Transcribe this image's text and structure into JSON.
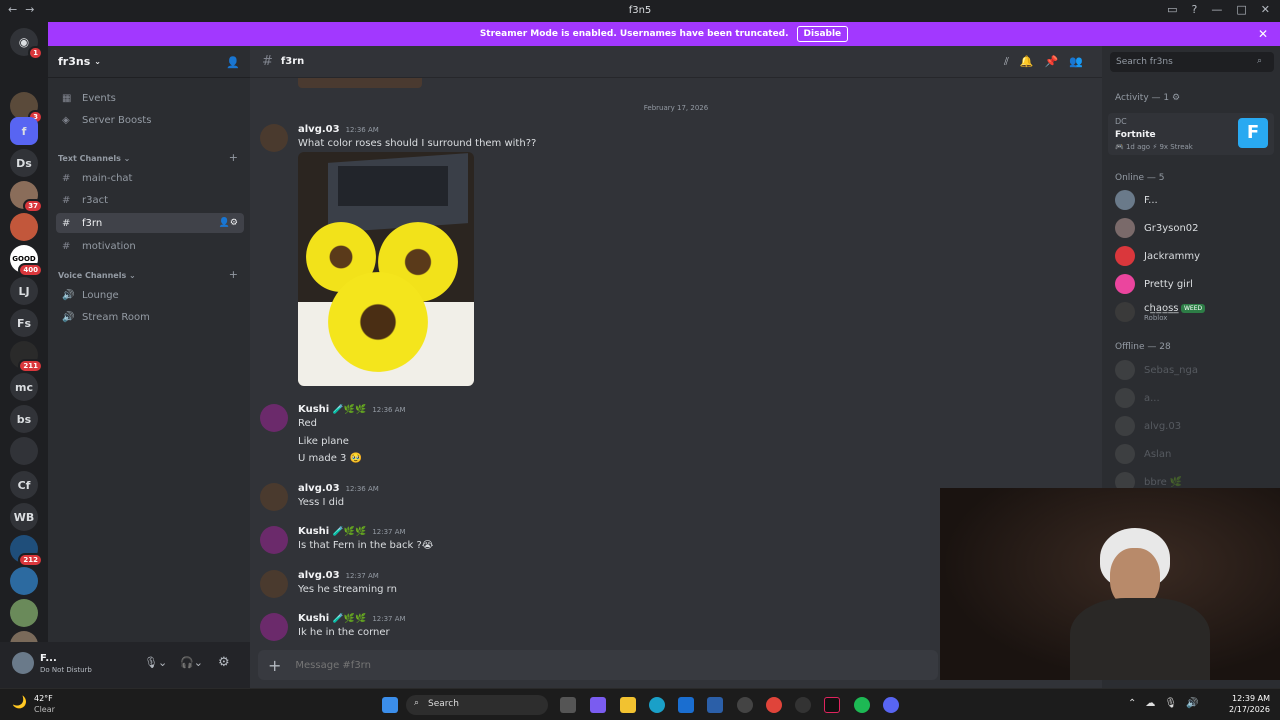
{
  "window": {
    "title": "f3n5"
  },
  "banner": {
    "text": "Streamer Mode is enabled. Usernames have been truncated.",
    "disable_label": "Disable"
  },
  "servers": [
    {
      "label": "",
      "badge": "1",
      "color": "#5865f2"
    },
    {
      "label": "",
      "badge": "3",
      "color": "#5a4a3a"
    },
    {
      "label": "f",
      "badge": "",
      "color": "#5865f2"
    },
    {
      "label": "Ds",
      "badge": "",
      "color": "#313338"
    },
    {
      "label": "",
      "badge": "37",
      "color": "#8a6d5a"
    },
    {
      "label": "",
      "badge": "",
      "color": "#c2573b"
    },
    {
      "label": "GOOD",
      "badge": "400",
      "color": "#ffffff"
    },
    {
      "label": "LJ",
      "badge": "",
      "color": "#313338"
    },
    {
      "label": "Fs",
      "badge": "",
      "color": "#313338"
    },
    {
      "label": "",
      "badge": "211",
      "color": "#2a2a2a"
    },
    {
      "label": "mc",
      "badge": "",
      "color": "#313338"
    },
    {
      "label": "bs",
      "badge": "",
      "color": "#313338"
    },
    {
      "label": "",
      "badge": "",
      "color": "#313338"
    },
    {
      "label": "Cf",
      "badge": "",
      "color": "#313338"
    },
    {
      "label": "WB",
      "badge": "",
      "color": "#313338"
    },
    {
      "label": "",
      "badge": "212",
      "color": "#1f4e7a"
    },
    {
      "label": "",
      "badge": "",
      "color": "#2c6aa0"
    },
    {
      "label": "",
      "badge": "",
      "color": "#6a8a5a"
    },
    {
      "label": "",
      "badge": "",
      "color": "#7a6a5a"
    }
  ],
  "sidebar": {
    "server_name": "fr3ns",
    "items": [
      {
        "label": "Events",
        "icon": "calendar-icon"
      },
      {
        "label": "Server Boosts",
        "icon": "boost-icon"
      }
    ],
    "text_category": "Text Channels",
    "text_channels": [
      "main-chat",
      "r3act",
      "f3rn",
      "motivation"
    ],
    "voice_category": "Voice Channels",
    "voice_channels": [
      "Lounge",
      "Stream Room"
    ]
  },
  "user": {
    "name": "F...",
    "status": "Do Not Disturb"
  },
  "chat": {
    "channel": "f3rn",
    "date_divider": "February 17, 2026",
    "input_placeholder": "Message #f3rn",
    "messages": [
      {
        "author": "alvg.03",
        "time": "12:36 AM",
        "lines": [
          "What color roses should I surround them with??"
        ]
      },
      {
        "author": "Kushi",
        "time": "12:36 AM",
        "lines": [
          "Red",
          "Like plane",
          "U made 3 🥹"
        ]
      },
      {
        "author": "alvg.03",
        "time": "12:36 AM",
        "lines": [
          "Yess I did"
        ]
      },
      {
        "author": "Kushi",
        "time": "12:37 AM",
        "lines": [
          "Is that Fern in the back ?😭"
        ]
      },
      {
        "author": "alvg.03",
        "time": "12:37 AM",
        "lines": [
          "Yes he streaming rn"
        ]
      },
      {
        "author": "Kushi",
        "time": "12:37 AM",
        "lines": [
          "Ik he in the corner"
        ]
      }
    ]
  },
  "members": {
    "search_placeholder": "Search fr3ns",
    "activity_header": "Activity — 1",
    "activity": {
      "user": "DC",
      "game": "Fortnite",
      "meta": "1d ago",
      "streak": "9x Streak"
    },
    "online_header": "Online — 5",
    "online": [
      {
        "name": "F...",
        "sub": "",
        "color": "#6a7a8a"
      },
      {
        "name": "Gr3yson02",
        "sub": "",
        "color": "#7a6a6a"
      },
      {
        "name": "Jackrammy",
        "sub": "",
        "color": "#da373c"
      },
      {
        "name": "Pretty girl",
        "sub": "",
        "color": "#eb459e"
      },
      {
        "name": "ch̲a̲o̲s̲s̲",
        "sub": "Roblox",
        "tag": "WEED",
        "color": "#3a3a3a"
      }
    ],
    "offline_header": "Offline — 28",
    "offline": [
      "Sebas_nga",
      "a...",
      "alvg.03",
      "Aslan",
      "bbre 🌿"
    ]
  },
  "taskbar": {
    "weather_temp": "42°F",
    "weather_desc": "Clear",
    "search_label": "Search",
    "time": "12:39 AM",
    "date": "2/17/2026"
  }
}
